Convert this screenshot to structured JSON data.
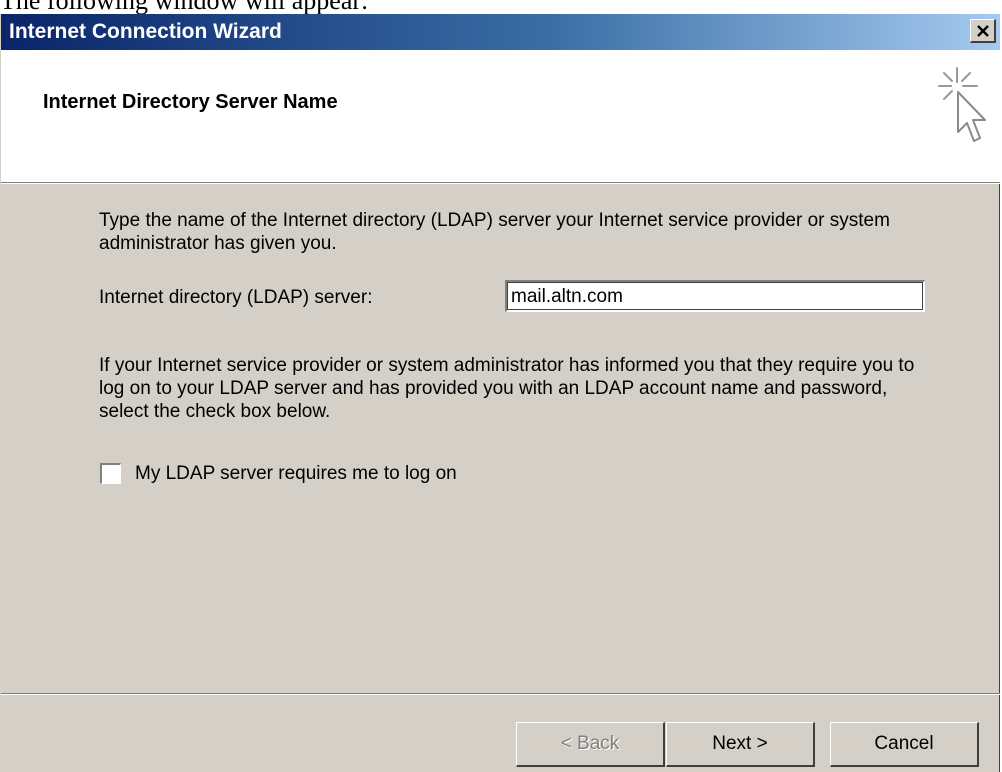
{
  "document": {
    "caption": "The following window will appear:"
  },
  "window": {
    "title": "Internet Connection Wizard",
    "close_glyph": "✕"
  },
  "header": {
    "title": "Internet Directory Server Name",
    "icon": "wizard-cursor-icon"
  },
  "content": {
    "instruction": "Type the name of the Internet directory (LDAP) server your Internet service provider or system administrator has given you.",
    "server_label": "Internet directory (LDAP) server:",
    "server_value": "mail.altn.com",
    "logon_instruction": "If your Internet service provider or system administrator has informed you that they require you to log on to your LDAP server and has provided you with an LDAP account name and password, select the check box below.",
    "logon_checkbox_label": "My LDAP server requires me to log on",
    "logon_checked": false
  },
  "buttons": {
    "back": "< Back",
    "next": "Next >",
    "cancel": "Cancel"
  }
}
